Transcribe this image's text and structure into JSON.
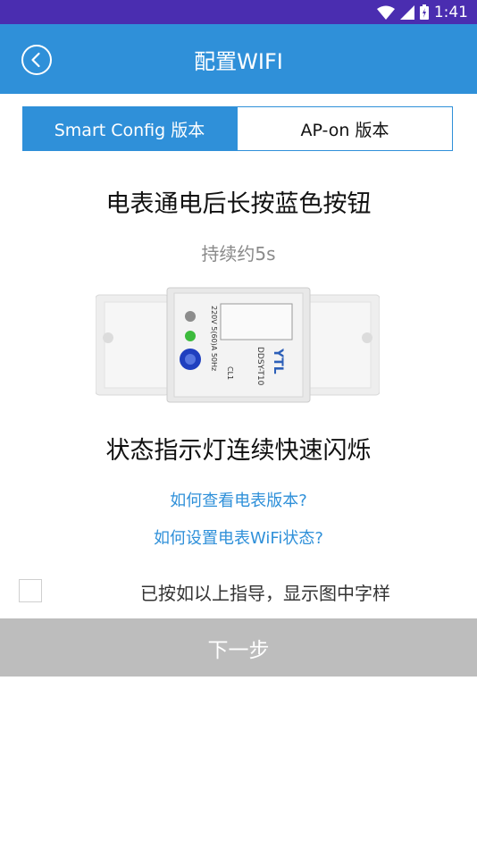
{
  "status_bar": {
    "time": "1:41"
  },
  "app_bar": {
    "title": "配置WIFI"
  },
  "tabs": [
    {
      "label": "Smart Config 版本",
      "active": true
    },
    {
      "label": "AP-on 版本",
      "active": false
    }
  ],
  "instructions": {
    "step1": "电表通电后长按蓝色按钮",
    "duration": "持续约5s",
    "step2": "状态指示灯连续快速闪烁"
  },
  "device_image": {
    "brand": "YTL",
    "model": "DDSY-T10",
    "specs": "220V 5(60)A 50Hz",
    "class": "CL1"
  },
  "links": {
    "check_version": "如何查看电表版本?",
    "wifi_status": "如何设置电表WiFi状态?"
  },
  "confirmation": {
    "label": "已按如以上指导，显示图中字样",
    "checked": false
  },
  "next_button": {
    "label": "下一步",
    "enabled": false
  },
  "colors": {
    "primary": "#2f90d9",
    "status_bar": "#4a2db0",
    "disabled_button": "#bdbdbd"
  }
}
